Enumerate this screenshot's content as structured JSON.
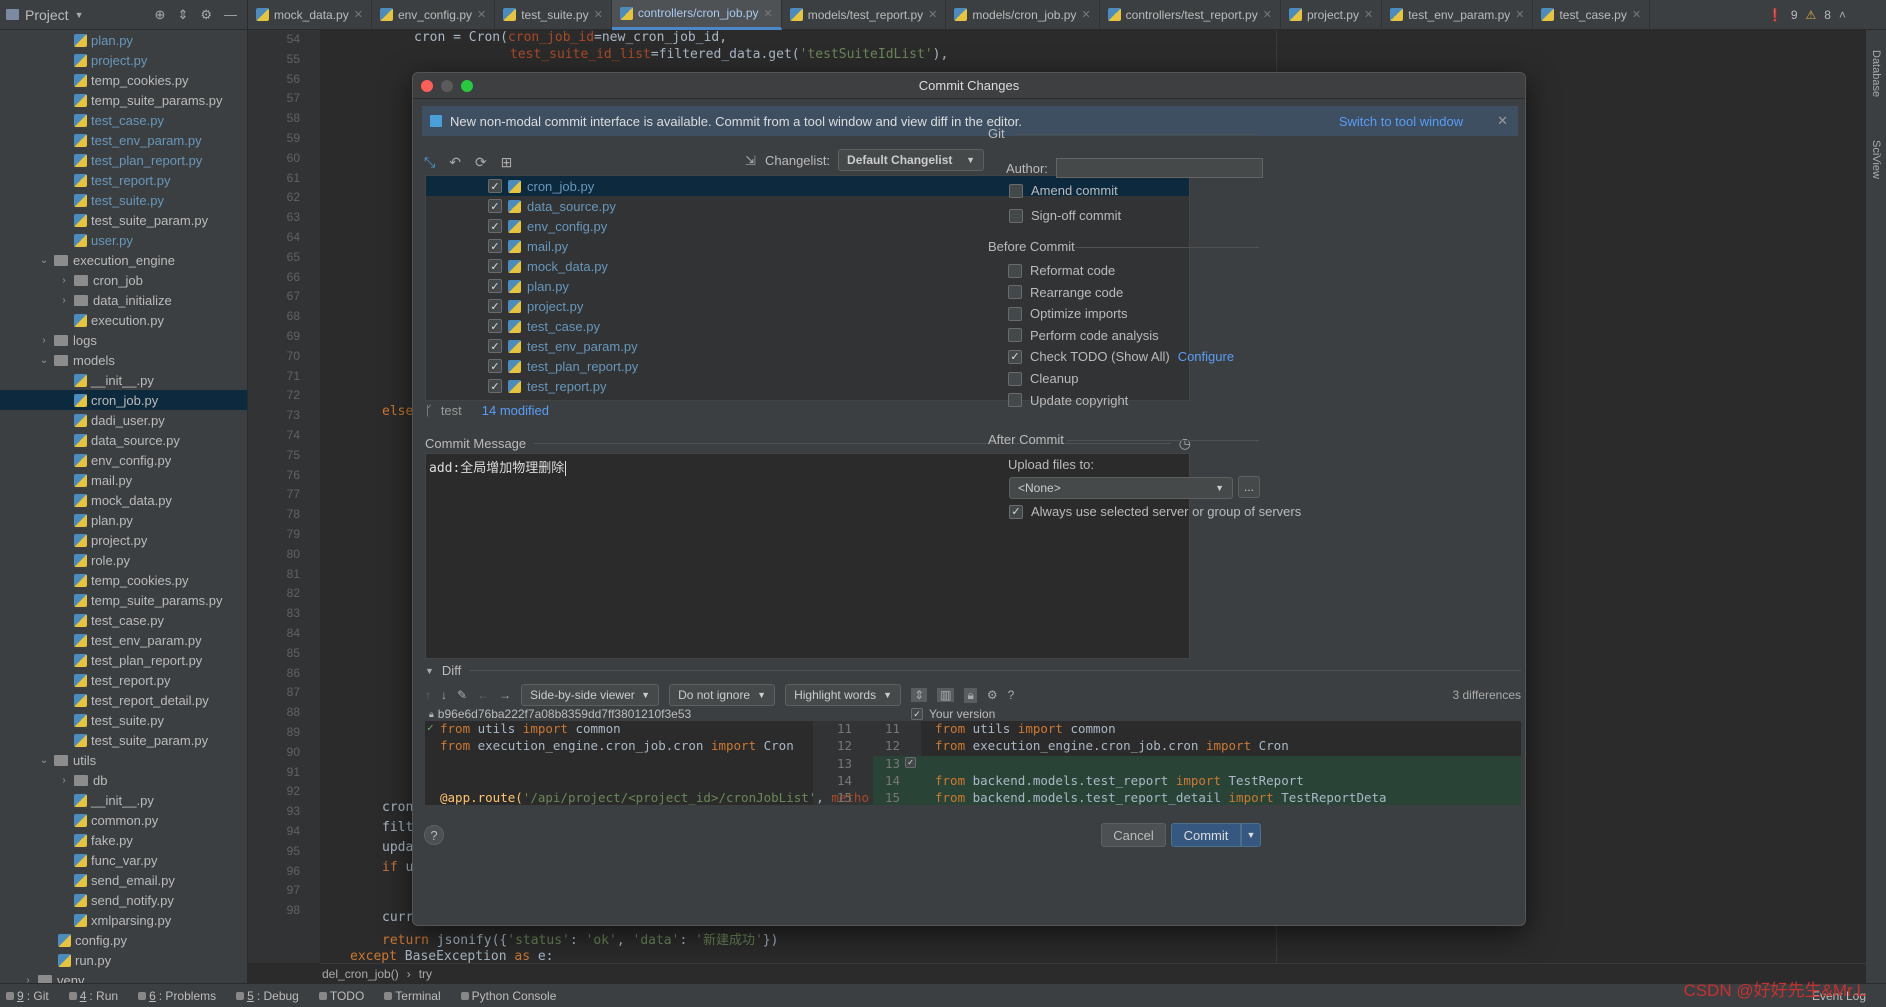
{
  "project_label": "Project",
  "tabs": [
    {
      "label": "mock_data.py"
    },
    {
      "label": "env_config.py"
    },
    {
      "label": "test_suite.py"
    },
    {
      "label": "controllers/cron_job.py",
      "active": true
    },
    {
      "label": "models/test_report.py"
    },
    {
      "label": "models/cron_job.py"
    },
    {
      "label": "controllers/test_report.py"
    },
    {
      "label": "project.py"
    },
    {
      "label": "test_env_param.py"
    },
    {
      "label": "test_case.py"
    }
  ],
  "inspections": {
    "errors": "9",
    "warnings": "8"
  },
  "tree": [
    {
      "label": "plan.py",
      "type": "file",
      "mod": true
    },
    {
      "label": "project.py",
      "type": "file",
      "mod": true
    },
    {
      "label": "temp_cookies.py",
      "type": "file"
    },
    {
      "label": "temp_suite_params.py",
      "type": "file"
    },
    {
      "label": "test_case.py",
      "type": "file",
      "mod": true
    },
    {
      "label": "test_env_param.py",
      "type": "file",
      "mod": true
    },
    {
      "label": "test_plan_report.py",
      "type": "file",
      "mod": true
    },
    {
      "label": "test_report.py",
      "type": "file",
      "mod": true
    },
    {
      "label": "test_suite.py",
      "type": "file",
      "mod": true
    },
    {
      "label": "test_suite_param.py",
      "type": "file"
    },
    {
      "label": "user.py",
      "type": "file",
      "mod": true
    },
    {
      "label": "execution_engine",
      "type": "folder",
      "open": true,
      "indent": 0
    },
    {
      "label": "cron_job",
      "type": "folder",
      "indent": 1
    },
    {
      "label": "data_initialize",
      "type": "folder",
      "indent": 1
    },
    {
      "label": "execution.py",
      "type": "file"
    },
    {
      "label": "logs",
      "type": "folder",
      "indent": 0
    },
    {
      "label": "models",
      "type": "folder",
      "open": true,
      "indent": 0
    },
    {
      "label": "__init__.py",
      "type": "file"
    },
    {
      "label": "cron_job.py",
      "type": "file",
      "sel": true
    },
    {
      "label": "dadi_user.py",
      "type": "file"
    },
    {
      "label": "data_source.py",
      "type": "file"
    },
    {
      "label": "env_config.py",
      "type": "file"
    },
    {
      "label": "mail.py",
      "type": "file"
    },
    {
      "label": "mock_data.py",
      "type": "file"
    },
    {
      "label": "plan.py",
      "type": "file"
    },
    {
      "label": "project.py",
      "type": "file"
    },
    {
      "label": "role.py",
      "type": "file"
    },
    {
      "label": "temp_cookies.py",
      "type": "file"
    },
    {
      "label": "temp_suite_params.py",
      "type": "file"
    },
    {
      "label": "test_case.py",
      "type": "file"
    },
    {
      "label": "test_env_param.py",
      "type": "file"
    },
    {
      "label": "test_plan_report.py",
      "type": "file"
    },
    {
      "label": "test_report.py",
      "type": "file"
    },
    {
      "label": "test_report_detail.py",
      "type": "file"
    },
    {
      "label": "test_suite.py",
      "type": "file"
    },
    {
      "label": "test_suite_param.py",
      "type": "file"
    },
    {
      "label": "utils",
      "type": "folder",
      "open": true,
      "indent": 0
    },
    {
      "label": "db",
      "type": "folder",
      "indent": 1
    },
    {
      "label": "__init__.py",
      "type": "file"
    },
    {
      "label": "common.py",
      "type": "file"
    },
    {
      "label": "fake.py",
      "type": "file"
    },
    {
      "label": "func_var.py",
      "type": "file"
    },
    {
      "label": "send_email.py",
      "type": "file"
    },
    {
      "label": "send_notify.py",
      "type": "file"
    },
    {
      "label": "xmlparsing.py",
      "type": "file"
    },
    {
      "label": "config.py",
      "type": "file",
      "indent": -1
    },
    {
      "label": "run.py",
      "type": "file",
      "indent": -1
    },
    {
      "label": "venv",
      "type": "folder",
      "indent": -1
    }
  ],
  "line_numbers": [
    "54",
    "55",
    "56",
    "57",
    "58",
    "59",
    "60",
    "61",
    "62",
    "63",
    "64",
    "65",
    "66",
    "67",
    "68",
    "69",
    "70",
    "71",
    "72",
    "73",
    "74",
    "75",
    "76",
    "77",
    "78",
    "79",
    "80",
    "81",
    "82",
    "83",
    "84",
    "85",
    "86",
    "87",
    "88",
    "89",
    "90",
    "91",
    "92",
    "93",
    "94",
    "95",
    "96",
    "97",
    "98"
  ],
  "editor": {
    "l54_a": "cron = Cron(",
    "l54_p": "cron_job_id",
    "l54_b": "=new_cron_job_id,",
    "l55_p": "test_suite_id_list",
    "l55_b": "=filtered_data.get(",
    "l55_s": "'testSuiteIdList'",
    "l55_c": "),",
    "l72": "else",
    "l91": "cron",
    "l92": "filt",
    "l93": "upda",
    "l94_k": "if",
    "l94_b": " u",
    "l96": "curr",
    "l97_k": "return",
    "l97_b": " jsonify({",
    "l97_s1": "'status'",
    "l97_c": ": ",
    "l97_s2": "'ok'",
    "l97_c2": ", ",
    "l97_s3": "'data'",
    "l97_c3": ": ",
    "l97_s4": "'新建成功'",
    "l97_e": "})",
    "l98_k": "except",
    "l98_b": " BaseException ",
    "l98_k2": "as",
    "l98_c": " e:"
  },
  "breadcrumb": [
    "del_cron_job()",
    "try"
  ],
  "statusbar": [
    {
      "icon": "git-icon",
      "num": "9",
      "label": ": Git"
    },
    {
      "icon": "run-icon",
      "num": "4",
      "label": ": Run"
    },
    {
      "icon": "problems-icon",
      "num": "6",
      "label": ": Problems"
    },
    {
      "icon": "debug-icon",
      "num": "5",
      "label": ": Debug"
    },
    {
      "icon": "todo-icon",
      "num": "",
      "label": "TODO"
    },
    {
      "icon": "terminal-icon",
      "num": "",
      "label": "Terminal"
    },
    {
      "icon": "python-console-icon",
      "num": "",
      "label": "Python Console"
    }
  ],
  "event_log": "Event Log",
  "watermark": "CSDN @好好先生&Mr.L",
  "dialog": {
    "title": "Commit Changes",
    "info_text": "New non-modal commit interface is available. Commit from a tool window and view diff in the editor.",
    "info_link": "Switch to tool window",
    "changelist_label": "Changelist:",
    "changelist_value": "Default Changelist",
    "files": [
      "cron_job.py",
      "data_source.py",
      "env_config.py",
      "mail.py",
      "mock_data.py",
      "plan.py",
      "project.py",
      "test_case.py",
      "test_env_param.py",
      "test_plan_report.py",
      "test_report.py"
    ],
    "branch": "test",
    "modified": "14 modified",
    "commit_message_label": "Commit Message",
    "commit_message": "add:全局增加物理删除",
    "git_label": "Git",
    "author_label": "Author:",
    "author_value": "",
    "amend": "Amend commit",
    "signoff": "Sign-off commit",
    "before_commit": "Before Commit",
    "before_items": [
      {
        "label": "Reformat code",
        "checked": false
      },
      {
        "label": "Rearrange code",
        "checked": false
      },
      {
        "label": "Optimize imports",
        "checked": false
      },
      {
        "label": "Perform code analysis",
        "checked": false
      },
      {
        "label": "Check TODO (Show All)",
        "checked": true,
        "link": "Configure"
      },
      {
        "label": "Cleanup",
        "checked": false
      },
      {
        "label": "Update copyright",
        "checked": false
      }
    ],
    "after_commit": "After Commit",
    "upload_label": "Upload files to:",
    "upload_value": "<None>",
    "browse_label": "...",
    "always_use": "Always use selected server or group of servers",
    "diff_label": "Diff",
    "viewer": "Side-by-side viewer",
    "ignore": "Do not ignore",
    "highlight": "Highlight words",
    "differences": "3 differences",
    "hash": "b96e6d76ba222f7a08b8359dd7ff3801210f3e53",
    "your_version": "Your version",
    "diff_left": [
      {
        "num": "11",
        "code": [
          [
            "kw",
            "from"
          ],
          [
            "t",
            " utils "
          ],
          [
            "kw",
            "import"
          ],
          [
            "t",
            " common"
          ]
        ]
      },
      {
        "num": "12",
        "code": [
          [
            "kw",
            "from"
          ],
          [
            "t",
            " execution_engine.cron_job.cron "
          ],
          [
            "kw",
            "import"
          ],
          [
            "t",
            " Cron"
          ]
        ]
      },
      {
        "num": "13",
        "code": []
      },
      {
        "num": "14",
        "code": []
      },
      {
        "num": "15",
        "code": [
          [
            "fn",
            "@app.route("
          ],
          [
            "str",
            "'/api/project/<project_id>/cronJobList'"
          ],
          [
            "t",
            ", "
          ],
          [
            "prm",
            "metho"
          ]
        ]
      }
    ],
    "diff_right": [
      {
        "num": "11",
        "code": [
          [
            "kw",
            "from"
          ],
          [
            "t",
            " utils "
          ],
          [
            "kw",
            "import"
          ],
          [
            "t",
            " common"
          ]
        ]
      },
      {
        "num": "12",
        "code": [
          [
            "kw",
            "from"
          ],
          [
            "t",
            " execution_engine.cron_job.cron "
          ],
          [
            "kw",
            "import"
          ],
          [
            "t",
            " Cron"
          ]
        ]
      },
      {
        "num": "13",
        "code": []
      },
      {
        "num": "14",
        "code": [
          [
            "kw",
            "from"
          ],
          [
            "t",
            " backend.models.test_report "
          ],
          [
            "kw",
            "import"
          ],
          [
            "t",
            " TestReport"
          ]
        ]
      },
      {
        "num": "15",
        "code": [
          [
            "kw",
            "from"
          ],
          [
            "t",
            " backend.models.test_report_detail "
          ],
          [
            "kw",
            "import"
          ],
          [
            "t",
            " TestReportDeta"
          ]
        ]
      }
    ],
    "help": "?",
    "cancel": "Cancel",
    "commit": "Commit"
  }
}
